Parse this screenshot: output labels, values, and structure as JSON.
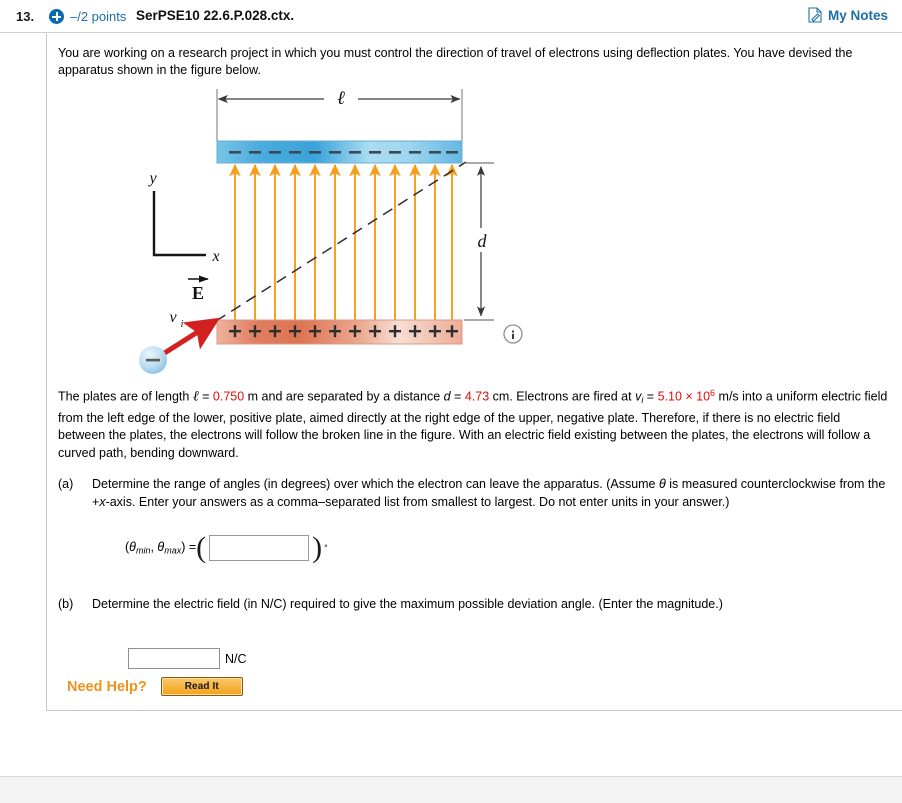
{
  "header": {
    "question_number": "13.",
    "points": "–/2 points",
    "question_code": "SerPSE10 22.6.P.028.ctx.",
    "my_notes": "My Notes",
    "accent_blue": "#1d6fa5",
    "badge_color": "#0a6ab0"
  },
  "intro": "You are working on a research project in which you must control the direction of travel of electrons using deflection plates. You have devised the apparatus shown in the figure below.",
  "figure": {
    "length_label": "ℓ",
    "gap_label": "d",
    "y_axis_label": "y",
    "x_axis_label": "x",
    "field_label": "E",
    "velocity_label": "v",
    "velocity_sub": "i",
    "top_plate_sign": "–",
    "bottom_plate_sign": "+",
    "electron_sign": "–",
    "info_icon": "info-icon",
    "top_plate_color": "#5cb3e0",
    "bottom_plate_color": "#e8947a",
    "field_arrow_color": "#f59c1a",
    "velocity_arrow_color": "#d32020",
    "n_field_lines": 12,
    "n_plate_signs": 12
  },
  "paragraph": {
    "p1": "The plates are of length ",
    "len_sym": "ℓ",
    "eq1": " = ",
    "len_val": "0.750",
    "p2": " m and are separated by a distance ",
    "d_sym": "d",
    "eq2": " = ",
    "d_val": "4.73",
    "p3": " cm. Electrons are fired at ",
    "v_sym": "v",
    "v_sub": "i",
    "eq3": " = ",
    "v_val": "5.10 × 10",
    "v_exp": "6",
    "p4": " m/s into a uniform electric field from the left edge of the lower, positive plate, aimed directly at the right edge of the upper, negative plate. Therefore, if there is no electric field between the plates, the electrons will follow the broken line in the figure. With an electric field existing between the plates, the electrons will follow a curved path, bending downward."
  },
  "parts": {
    "a": {
      "label": "(a)",
      "text_1": "Determine the range of angles (in degrees) over which the electron can leave the apparatus. (Assume ",
      "theta": "θ",
      "text_2": " is measured counterclockwise from the +",
      "x_sym": "x",
      "text_3": "-axis. Enter your answers as a comma–separated list from smallest to largest. Do not enter units in your answer.)",
      "answer_prefix_theta": "θ",
      "answer_sub_min": "min",
      "answer_comma": ", ",
      "answer_sub_max": "max",
      "answer_equals": " = ",
      "input_value": "",
      "input_placeholder": "",
      "degree_symbol": "°"
    },
    "b": {
      "label": "(b)",
      "text": "Determine the electric field (in N/C) required to give the maximum possible deviation angle. (Enter the magnitude.)",
      "input_value": "",
      "input_placeholder": "",
      "unit": "N/C"
    }
  },
  "need_help": {
    "label": "Need Help?",
    "button": "Read It"
  }
}
